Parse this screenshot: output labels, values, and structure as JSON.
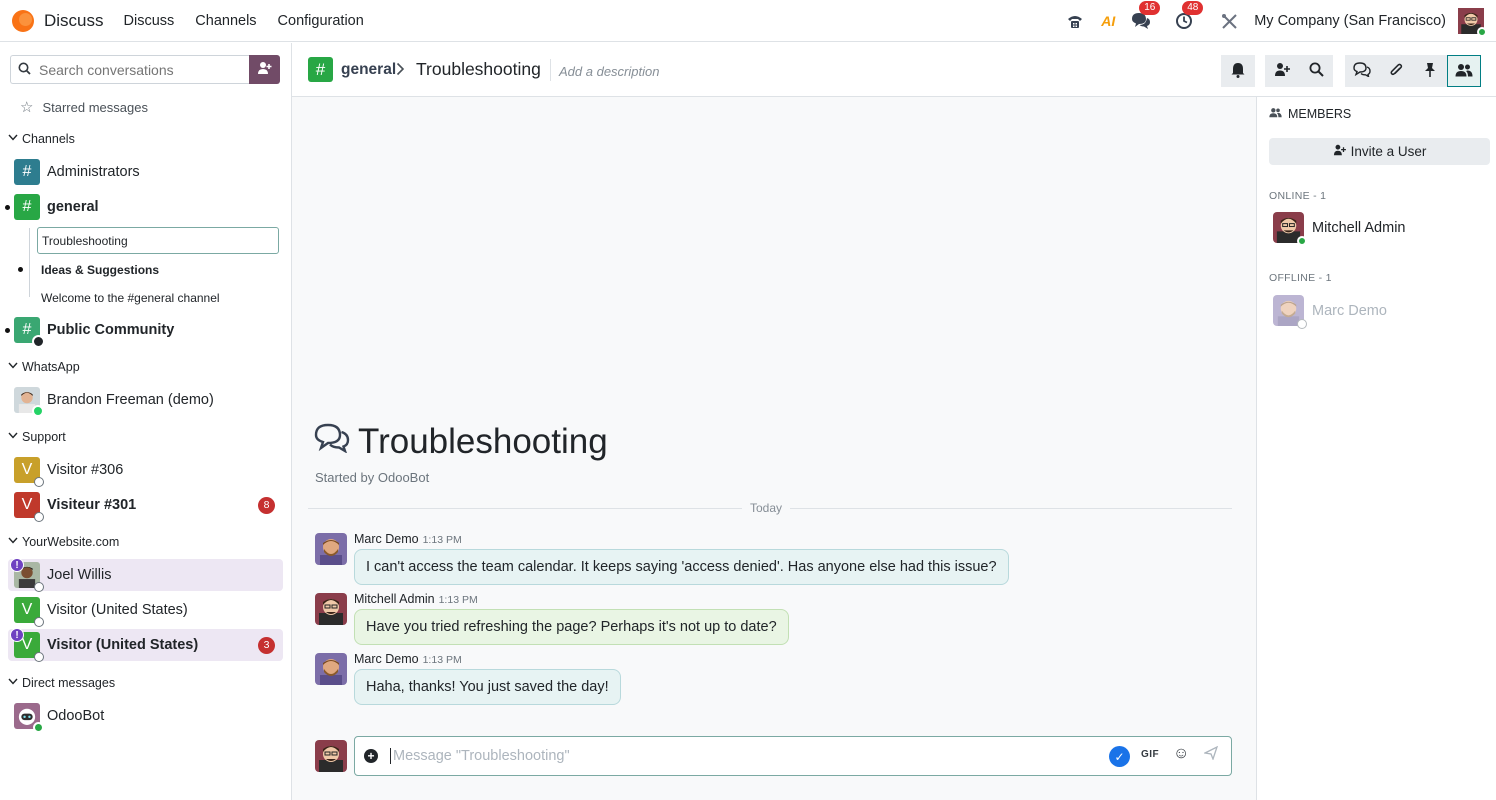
{
  "navbar": {
    "app_name": "Discuss",
    "menu": [
      "Discuss",
      "Channels",
      "Configuration"
    ],
    "messages_badge": "16",
    "activity_badge": "48",
    "ai_label": "AI",
    "company": "My Company (San Francisco)"
  },
  "sidebar": {
    "search_placeholder": "Search conversations",
    "starred": "Starred messages",
    "categories": {
      "channels": "Channels",
      "whatsapp": "WhatsApp",
      "support": "Support",
      "website": "YourWebsite.com",
      "direct": "Direct messages"
    },
    "channels": [
      {
        "name": "Administrators"
      },
      {
        "name": "general"
      },
      {
        "name": "Public Community"
      }
    ],
    "subchannels": [
      "Troubleshooting",
      "Ideas & Suggestions",
      "Welcome to the #general channel"
    ],
    "whatsapp": [
      {
        "name": "Brandon Freeman (demo)"
      }
    ],
    "support": [
      {
        "name": "Visitor #306",
        "initial": "V"
      },
      {
        "name": "Visiteur #301",
        "initial": "V",
        "counter": "8"
      }
    ],
    "website": [
      {
        "name": "Joel Willis",
        "alert": "!"
      },
      {
        "name": "Visitor (United States)",
        "initial": "V"
      },
      {
        "name": "Visitor (United States)",
        "initial": "V",
        "counter": "3",
        "alert": "!"
      }
    ],
    "direct": [
      {
        "name": "OdooBot"
      }
    ]
  },
  "thread": {
    "parent": "general",
    "title": "Troubleshooting",
    "description_placeholder": "Add a description",
    "intro_title": "Troubleshooting",
    "started_by": "Started by OdooBot",
    "day": "Today",
    "messages": [
      {
        "author": "Marc Demo",
        "time": "1:13 PM",
        "text": "I can't access the team calendar. It keeps saying 'access denied'. Has anyone else had this issue?"
      },
      {
        "author": "Mitchell Admin",
        "time": "1:13 PM",
        "text": "Have you tried refreshing the page? Perhaps it's not up to date?"
      },
      {
        "author": "Marc Demo",
        "time": "1:13 PM",
        "text": "Haha, thanks! You just saved the day!"
      }
    ],
    "composer_placeholder": "Message \"Troubleshooting\"",
    "gif_label": "GIF"
  },
  "members": {
    "title": "MEMBERS",
    "invite": "Invite a User",
    "online_label": "ONLINE - 1",
    "offline_label": "OFFLINE - 1",
    "online": [
      "Mitchell Admin"
    ],
    "offline": [
      "Marc Demo"
    ]
  },
  "colors": {
    "brand": "#714b67",
    "teal": "#017e84",
    "green_channel": "#28a745",
    "blue_channel": "#2e7d8f",
    "counter_red": "#c53030"
  },
  "icons": [
    "odoo-logo-icon",
    "phone-icon",
    "ai-icon",
    "chat-bubbles-icon",
    "clock-icon",
    "tools-icon",
    "search-icon",
    "add-user-icon",
    "star-icon",
    "chevron-down-icon",
    "hash-icon",
    "bell-icon",
    "threads-icon",
    "paperclip-icon",
    "pin-icon",
    "members-icon",
    "plus-circle-icon",
    "check-circle-icon",
    "gif-icon",
    "emoji-icon",
    "send-icon"
  ]
}
